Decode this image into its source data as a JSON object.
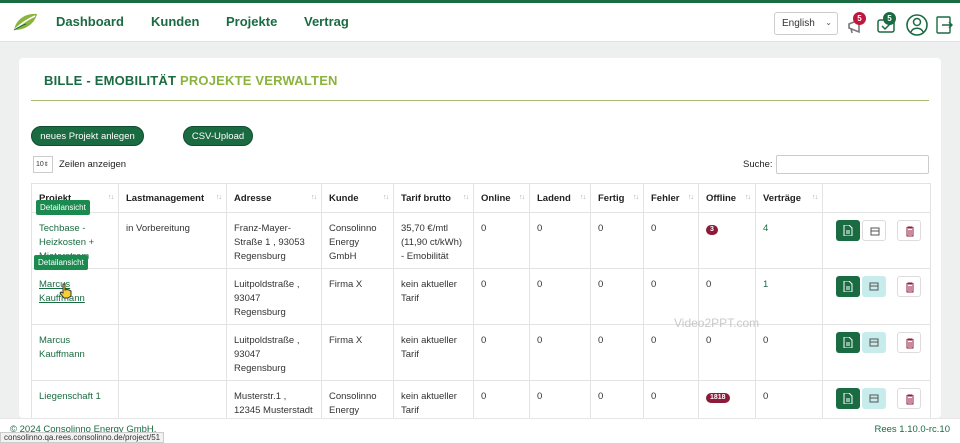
{
  "nav": {
    "logo_icon": "leaf-logo-icon",
    "items": [
      "Dashboard",
      "Kunden",
      "Projekte",
      "Vertrag"
    ]
  },
  "header": {
    "language": "English",
    "notifications_badge": "5",
    "tasks_badge": "5"
  },
  "page": {
    "title_part1": "BILLE - EMOBILITÄT",
    "title_part2": "PROJEKTE VERWALTEN",
    "new_project_button": "neues Projekt anlegen",
    "csv_upload_button": "CSV-Upload",
    "page_length_value": "10",
    "page_length_label": "Zeilen anzeigen",
    "search_label": "Suche:"
  },
  "table": {
    "headers": [
      "Projekt",
      "Lastmanagement",
      "Adresse",
      "Kunde",
      "Tarif brutto",
      "Online",
      "Ladend",
      "Fertig",
      "Fehler",
      "Offline",
      "Verträge",
      ""
    ],
    "rows": [
      {
        "projekt": "Techbase - Heizkosten + Mieterstrom",
        "lastmanagement": "in Vorbereitung",
        "adresse": "Franz-Mayer-Straße 1 , 93053 Regensburg",
        "kunde": "Consolinno Energy GmbH",
        "tarif": "35,70 €/mtl (11,90 ct/kWh) - Emobilität",
        "online": "0",
        "ladend": "0",
        "fertig": "0",
        "fehler": "0",
        "offline": "3",
        "vertraege": "4"
      },
      {
        "projekt": "Marcus Kauffmann",
        "lastmanagement": "",
        "adresse": "Luitpoldstraße , 93047 Regensburg",
        "kunde": "Firma X",
        "tarif": "kein aktueller Tarif",
        "online": "0",
        "ladend": "0",
        "fertig": "0",
        "fehler": "0",
        "offline": "0",
        "vertraege": "1"
      },
      {
        "projekt": "Marcus Kauffmann",
        "lastmanagement": "",
        "adresse": "Luitpoldstraße , 93047 Regensburg",
        "kunde": "Firma X",
        "tarif": "kein aktueller Tarif",
        "online": "0",
        "ladend": "0",
        "fertig": "0",
        "fehler": "0",
        "offline": "0",
        "vertraege": "0"
      },
      {
        "projekt": "Liegenschaft 1",
        "lastmanagement": "",
        "adresse": "Musterstr.1 , 12345 Musterstadt",
        "kunde": "Consolinno Energy GmbH",
        "tarif": "kein aktueller Tarif",
        "online": "0",
        "ladend": "0",
        "fertig": "0",
        "fehler": "0",
        "offline": "1818",
        "vertraege": "0"
      }
    ],
    "tooltip": "Detailansicht"
  },
  "footer": {
    "copyright": "© 2024 Consolinno Energy GmbH.",
    "version": "Rees 1.10.0-rc.10"
  },
  "statusbar": "consolinno.qa.rees.consolinno.de/project/51",
  "watermark": "Video2PPT.com",
  "colors": {
    "brand_green": "#1a6b42",
    "accent_lime": "#8ab43d",
    "badge_red": "#c0163e",
    "offline_pill": "#8c1a3a",
    "action_light": "#c8ecec"
  }
}
